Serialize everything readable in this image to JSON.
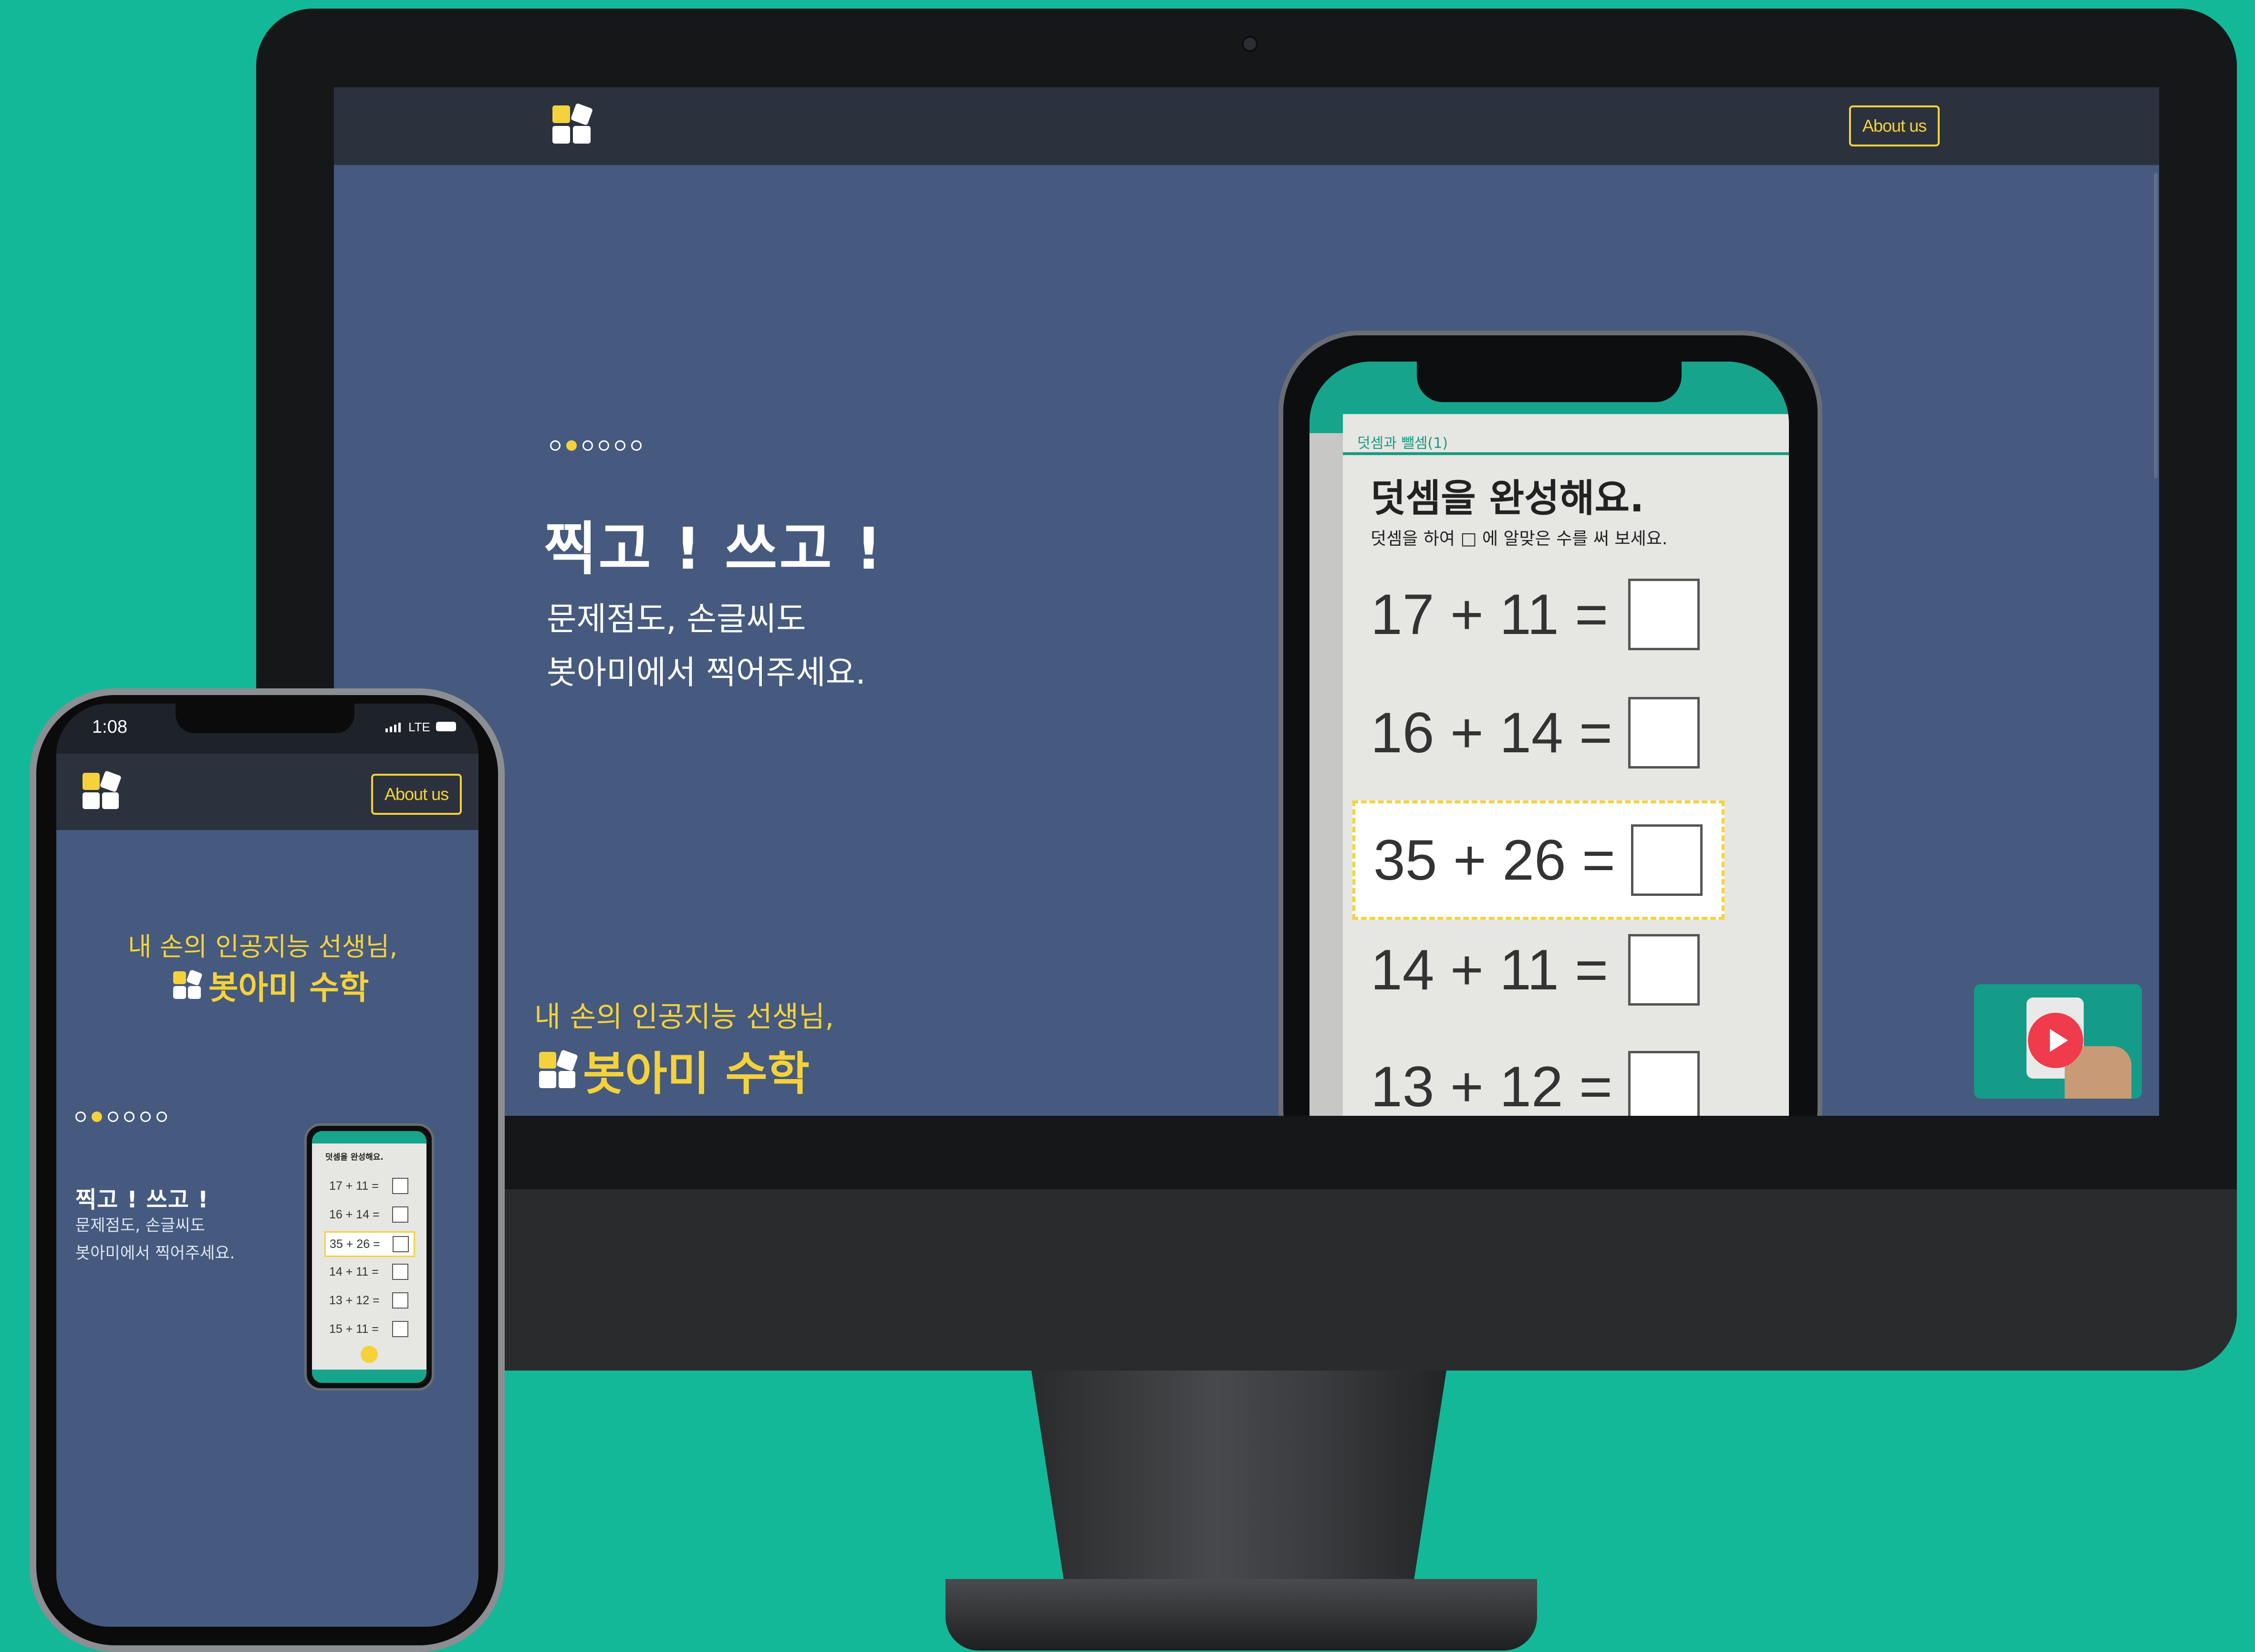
{
  "desktop": {
    "nav": {
      "about_label": "About us"
    },
    "slider": {
      "dot_count": 6,
      "active_index": 1
    },
    "hero": {
      "title": "찍고 ! 쓰고 !",
      "subtitle_line1": "문제점도, 손글씨도",
      "subtitle_line2": "봇아미에서 찍어주세요."
    },
    "tagline": "내 손의 인공지능 선생님,",
    "brand_name": "봇아미 수학",
    "worksheet": {
      "header_tag": "덧셈과 뺄셈(1)",
      "title": "덧셈을 완성해요.",
      "instruction": "덧셈을 하여 □ 에 알맞은 수를 써 보세요.",
      "equations": [
        "17 + 11 =",
        "16 + 14 =",
        "35 + 26 =",
        "14 + 11 =",
        "13 + 12 ="
      ],
      "highlighted_index": 2
    },
    "video": {
      "icon": "play-icon"
    }
  },
  "mobile": {
    "status": {
      "time": "1:08",
      "network": "LTE"
    },
    "nav": {
      "about_label": "About us"
    },
    "tagline": "내 손의 인공지능 선생님,",
    "brand_name": "봇아미 수학",
    "slider": {
      "dot_count": 6,
      "active_index": 1
    },
    "hero": {
      "title": "찍고 ! 쓰고 !",
      "subtitle_line1": "문제점도, 손글씨도",
      "subtitle_line2": "봇아미에서 찍어주세요."
    },
    "worksheet": {
      "title": "덧셈을 완성해요.",
      "equations": [
        "17 + 11 =",
        "16 + 14 =",
        "35 + 26 =",
        "14 + 11 =",
        "13 + 12 =",
        "15 + 11 ="
      ],
      "highlighted_index": 2
    }
  },
  "colors": {
    "background": "#13b898",
    "page": "#455a7e",
    "navbar": "#2c323d",
    "accent_yellow": "#f5d23b",
    "video_bg": "#149c88",
    "play_red": "#ef3b4c"
  }
}
